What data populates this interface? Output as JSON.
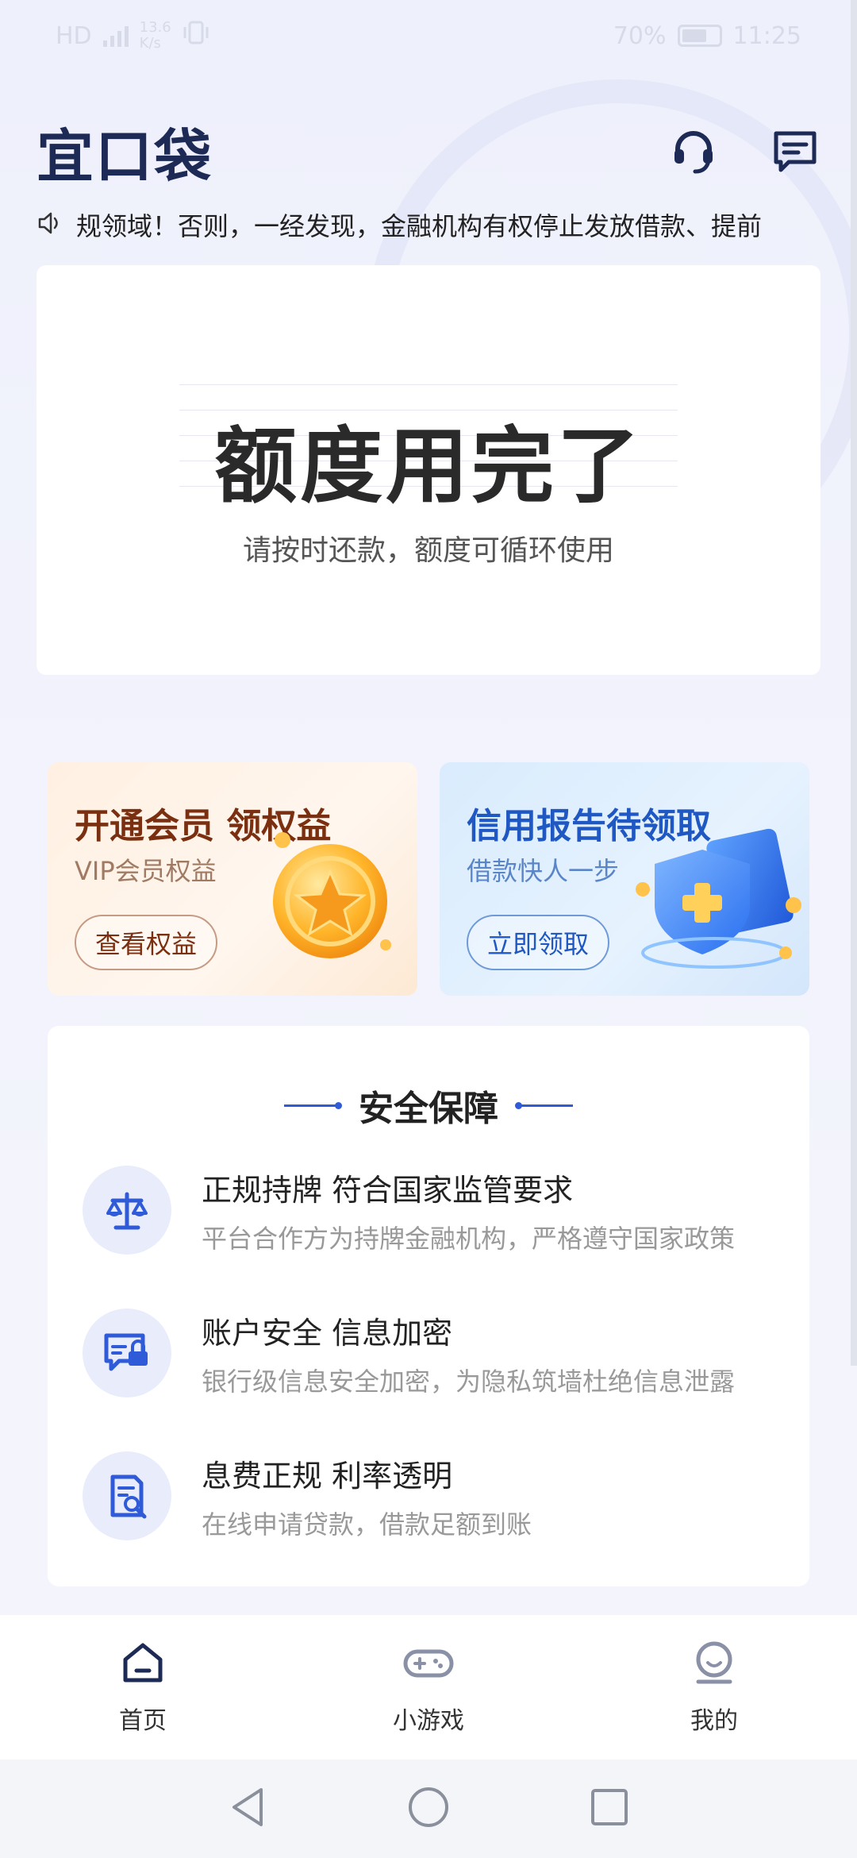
{
  "status_bar": {
    "network": "HD",
    "speed_value": "13.6",
    "speed_unit": "K/s",
    "battery": "70%",
    "battery_level": 0.7,
    "time": "11:25"
  },
  "header": {
    "logo": "宜口袋",
    "icons": [
      "headset-icon",
      "message-icon"
    ]
  },
  "notice": {
    "text": "规领域！否则，一经发现，金融机构有权停止发放借款、提前"
  },
  "quota": {
    "title": "额度用完了",
    "subtitle": "请按时还款，额度可循环使用"
  },
  "promos": [
    {
      "title": "开通会员 领权益",
      "subtitle": "VIP会员权益",
      "button": "查看权益"
    },
    {
      "title": "信用报告待领取",
      "subtitle": "借款快人一步",
      "button": "立即领取"
    }
  ],
  "security": {
    "title": "安全保障",
    "items": [
      {
        "icon": "scale-icon",
        "title": "正规持牌 符合国家监管要求",
        "desc": "平台合作方为持牌金融机构，严格遵守国家政策"
      },
      {
        "icon": "secure-message-icon",
        "title": "账户安全 信息加密",
        "desc": "银行级信息安全加密，为隐私筑墙杜绝信息泄露"
      },
      {
        "icon": "document-search-icon",
        "title": "息费正规  利率透明",
        "desc": "在线申请贷款，借款足额到账"
      }
    ]
  },
  "bottom_nav": [
    {
      "label": "首页",
      "icon": "home-icon",
      "active": true
    },
    {
      "label": "小游戏",
      "icon": "gamepad-icon",
      "active": false
    },
    {
      "label": "我的",
      "icon": "profile-icon",
      "active": false
    }
  ],
  "colors": {
    "brand": "#1d2a55",
    "accent": "#2f5ad8",
    "vip_text": "#7a2f10",
    "credit_text": "#1f57c3"
  }
}
